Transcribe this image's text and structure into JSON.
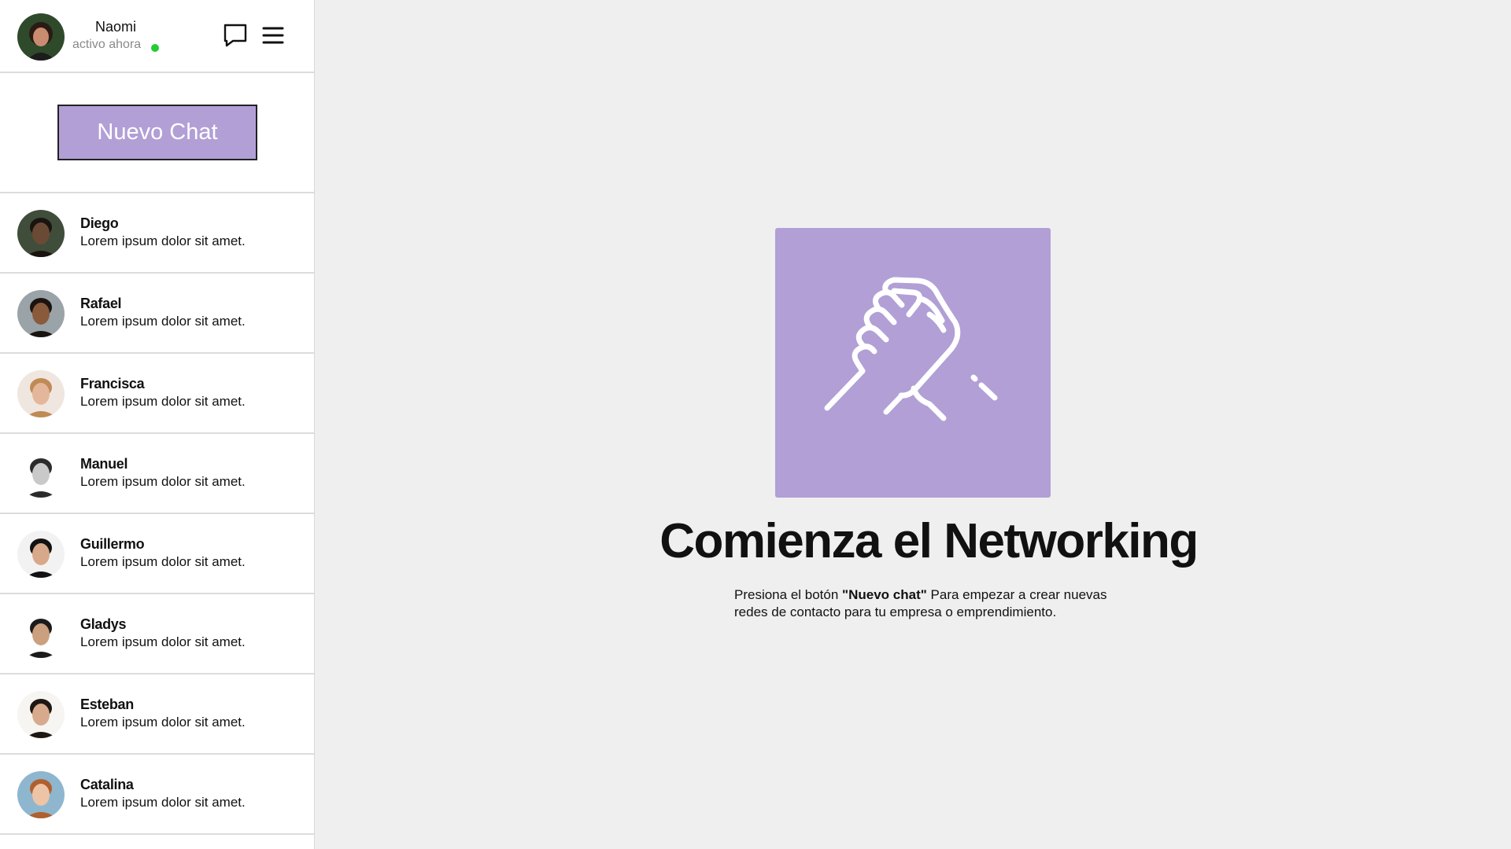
{
  "colors": {
    "accent": "#b19fd6",
    "online": "#22cc33",
    "background": "#efefef"
  },
  "profile": {
    "name": "Naomi",
    "status": "activo ahora"
  },
  "header_icons": [
    "chat-bubble-icon",
    "hamburger-menu-icon"
  ],
  "new_chat": {
    "label": "Nuevo Chat"
  },
  "contacts": [
    {
      "name": "Diego",
      "preview": "Lorem ipsum dolor sit amet."
    },
    {
      "name": "Rafael",
      "preview": "Lorem ipsum dolor sit amet."
    },
    {
      "name": "Francisca",
      "preview": "Lorem ipsum dolor sit amet."
    },
    {
      "name": "Manuel",
      "preview": "Lorem ipsum dolor sit amet."
    },
    {
      "name": "Guillermo",
      "preview": "Lorem ipsum dolor sit amet."
    },
    {
      "name": "Gladys",
      "preview": "Lorem ipsum dolor sit amet."
    },
    {
      "name": "Esteban",
      "preview": "Lorem ipsum dolor sit amet."
    },
    {
      "name": "Catalina",
      "preview": "Lorem ipsum dolor sit amet."
    }
  ],
  "main": {
    "illustration": "handshake-icon",
    "title": "Comienza el Networking",
    "text_prefix": "Presiona el botón ",
    "text_bold": "\"Nuevo chat\"",
    "text_suffix": " Para empezar a crear nuevas redes de contacto para tu empresa o emprendimiento."
  }
}
